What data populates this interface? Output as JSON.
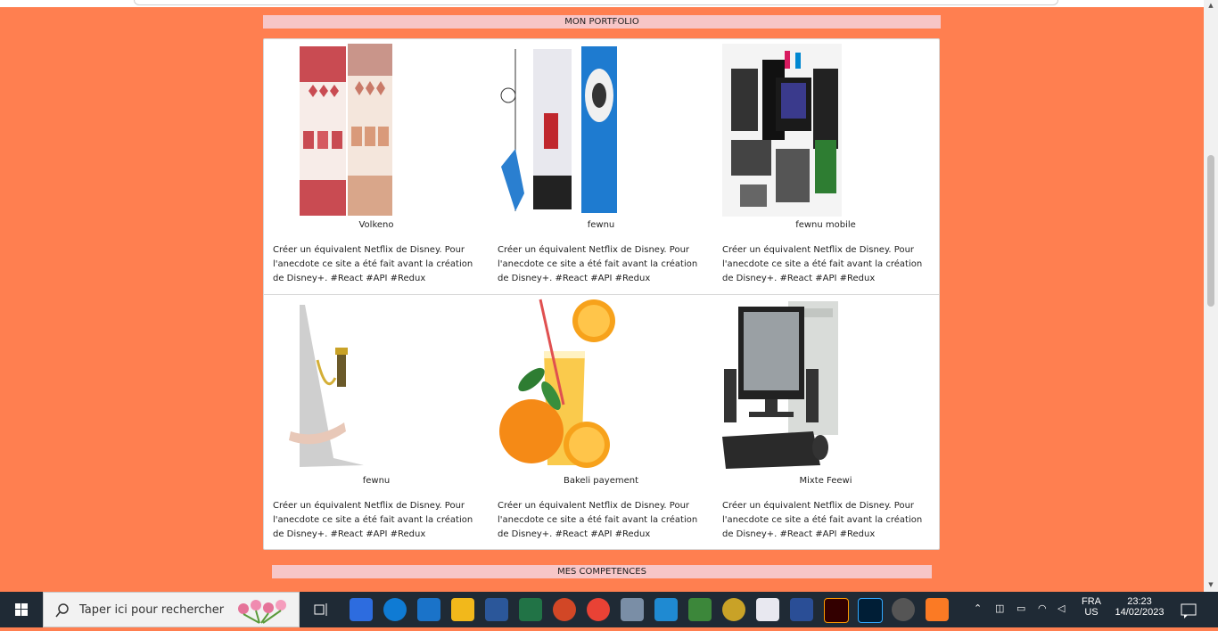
{
  "sections": {
    "portfolio_title": "MON PORTFOLIO",
    "competences_title": "MES COMPETENCES"
  },
  "projects": [
    {
      "title": "Volkeno",
      "description": "Créer un équivalent Netflix de Disney. Pour l'anecdote ce site a été fait avant la création de Disney+. #React #API #Redux"
    },
    {
      "title": "fewnu",
      "description": "Créer un équivalent Netflix de Disney. Pour l'anecdote ce site a été fait avant la création de Disney+. #React #API #Redux"
    },
    {
      "title": "fewnu mobile",
      "description": "Créer un équivalent Netflix de Disney. Pour l'anecdote ce site a été fait avant la création de Disney+. #React #API #Redux"
    },
    {
      "title": "fewnu",
      "description": "Créer un équivalent Netflix de Disney. Pour l'anecdote ce site a été fait avant la création de Disney+. #React #API #Redux"
    },
    {
      "title": "Bakeli payement",
      "description": "Créer un équivalent Netflix de Disney. Pour l'anecdote ce site a été fait avant la création de Disney+. #React #API #Redux"
    },
    {
      "title": "Mixte Feewi",
      "description": "Créer un équivalent Netflix de Disney. Pour l'anecdote ce site a été fait avant la création de Disney+. #React #API #Redux"
    }
  ],
  "taskbar": {
    "search_placeholder": "Taper ici pour rechercher",
    "language": "FRA",
    "layout": "US",
    "time": "23:23",
    "date": "14/02/2023",
    "apps": [
      "task-view",
      "store",
      "edge",
      "mail",
      "file-explorer",
      "word",
      "excel",
      "powerpoint",
      "chrome",
      "remote-desktop",
      "vscode",
      "node",
      "app",
      "paint",
      "powershell",
      "illustrator",
      "photoshop",
      "media",
      "xampp"
    ]
  },
  "colors": {
    "page_bg": "#ff7f50",
    "section_bar": "#f7c6c7",
    "taskbar": "#1f2a35"
  }
}
